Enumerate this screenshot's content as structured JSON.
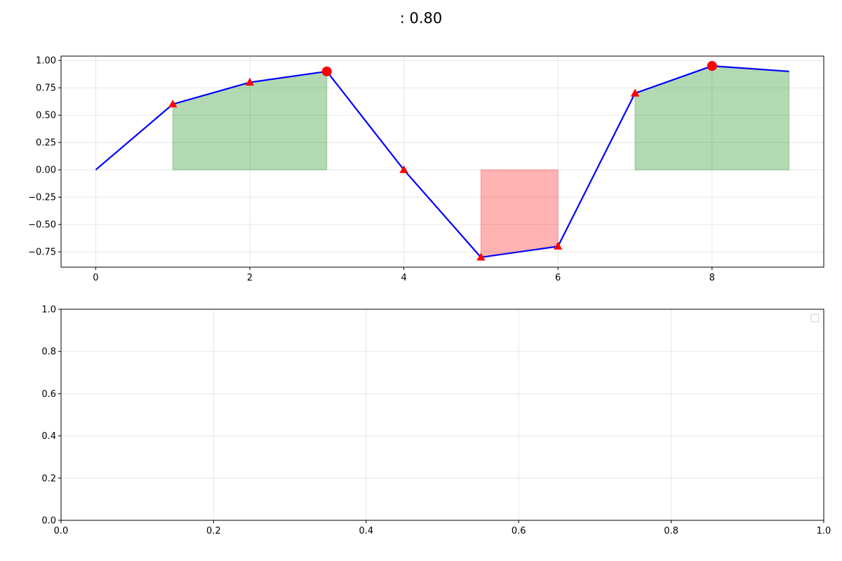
{
  "figure": {
    "title_prefix": "",
    "title_value": ": 0.80"
  },
  "chart_data": [
    {
      "type": "line",
      "title": "",
      "xlabel": "",
      "ylabel": "",
      "xlim": [
        -0.45,
        9.45
      ],
      "ylim": [
        -0.89,
        1.04
      ],
      "x_ticks": [
        0,
        2,
        4,
        6,
        8
      ],
      "y_ticks": [
        -0.75,
        -0.5,
        -0.25,
        0.0,
        0.25,
        0.5,
        0.75,
        1.0
      ],
      "grid": true,
      "series": [
        {
          "color": "#0000ff",
          "x": [
            0,
            1,
            2,
            3,
            4,
            5,
            6,
            7,
            8,
            9
          ],
          "y": [
            0.0,
            0.6,
            0.8,
            0.9,
            0.0,
            -0.8,
            -0.7,
            0.7,
            0.95,
            0.9
          ]
        }
      ],
      "triangle_markers": {
        "color": "#ff0000",
        "x": [
          1,
          2,
          3,
          4,
          5,
          6,
          7,
          8
        ],
        "y": [
          0.6,
          0.8,
          0.9,
          0.0,
          -0.8,
          -0.7,
          0.7,
          0.95
        ]
      },
      "circle_markers": {
        "color": "#ff0000",
        "x": [
          3,
          8
        ],
        "y": [
          0.9,
          0.95
        ]
      },
      "shaded_regions": [
        {
          "color": "#008000",
          "x": [
            1,
            2,
            3
          ],
          "y": [
            0.6,
            0.8,
            0.9
          ]
        },
        {
          "color": "#ff0000",
          "x": [
            5,
            6
          ],
          "y": [
            -0.8,
            -0.7
          ]
        },
        {
          "color": "#008000",
          "x": [
            7,
            8,
            9
          ],
          "y": [
            0.7,
            0.95,
            0.9
          ]
        }
      ]
    },
    {
      "type": "line",
      "title": "",
      "xlabel": "",
      "ylabel": "",
      "xlim": [
        0,
        1
      ],
      "ylim": [
        0,
        1
      ],
      "x_ticks": [
        0.0,
        0.2,
        0.4,
        0.6,
        0.8,
        1.0
      ],
      "y_ticks": [
        0.0,
        0.2,
        0.4,
        0.6,
        0.8,
        1.0
      ],
      "grid": true,
      "legend": "top-right",
      "series": []
    }
  ]
}
